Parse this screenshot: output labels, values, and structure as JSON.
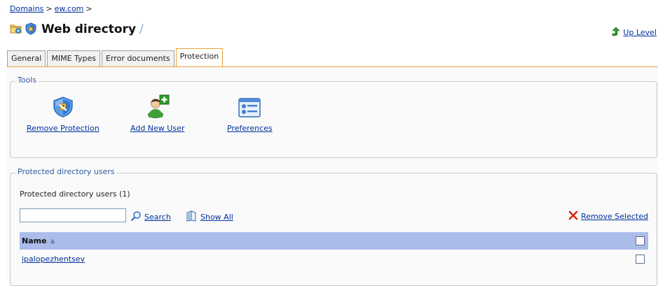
{
  "breadcrumb": {
    "items": [
      "Domains",
      "ew.com"
    ],
    "separator": ">"
  },
  "page": {
    "title": "Web directory",
    "title_suffix": "/",
    "up_level": "Up Level"
  },
  "tabs": [
    {
      "label": "General",
      "active": false
    },
    {
      "label": "MIME Types",
      "active": false
    },
    {
      "label": "Error documents",
      "active": false
    },
    {
      "label": "Protection",
      "active": true
    }
  ],
  "tools": {
    "legend": "Tools",
    "items": [
      {
        "label": "Remove Protection",
        "icon": "shield-key-icon"
      },
      {
        "label": "Add New User",
        "icon": "add-user-icon"
      },
      {
        "label": "Preferences",
        "icon": "preferences-icon"
      }
    ]
  },
  "users": {
    "legend": "Protected directory users",
    "count_label": "Protected directory users (1)",
    "search_value": "",
    "search_label": "Search",
    "show_all_label": "Show All",
    "remove_selected_label": "Remove Selected",
    "columns": {
      "name": "Name",
      "sort": "▲"
    },
    "rows": [
      {
        "name": "ipalopezhentsev",
        "checked": false
      }
    ]
  },
  "colors": {
    "link": "#00309c",
    "tab_active_border": "#e7a23c",
    "legend_text": "#2b5c9e",
    "table_header_bg": "#abbcea",
    "remove_icon": "#d42a1c",
    "up_icon": "#2f9a2a"
  }
}
